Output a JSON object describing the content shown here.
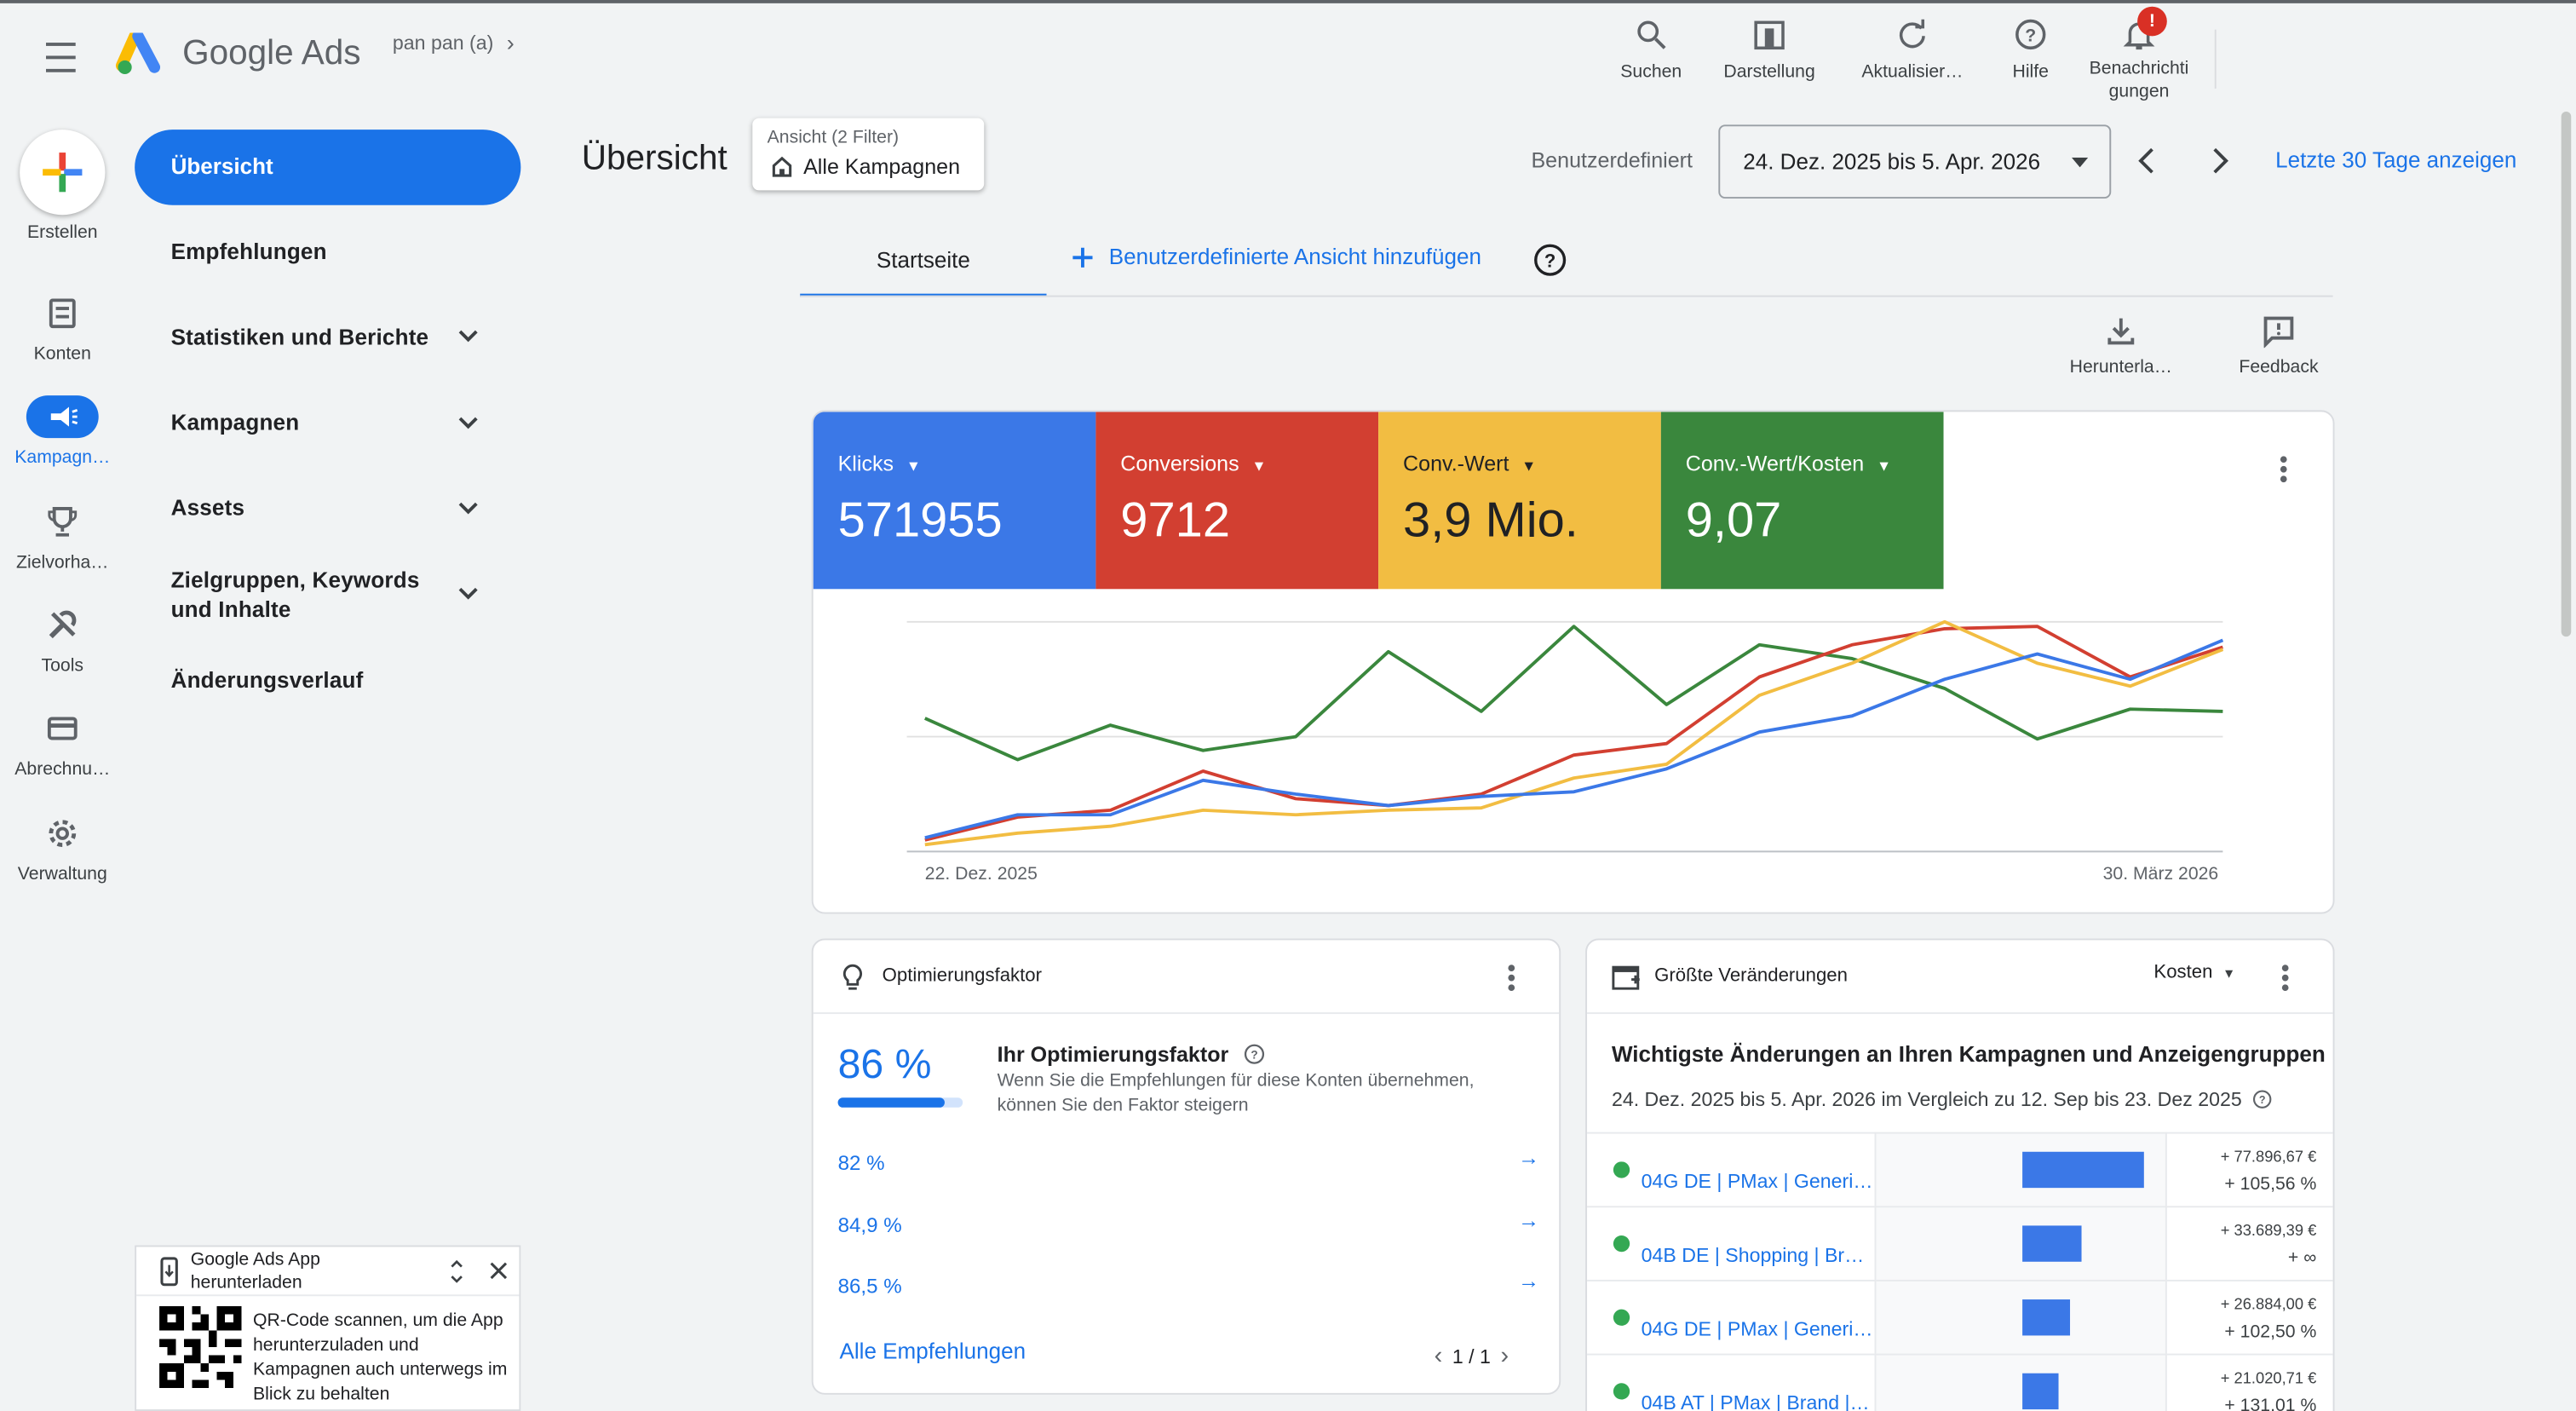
{
  "header": {
    "app_name": "Google Ads",
    "account": "pan pan (a)",
    "actions": [
      {
        "label": "Suchen",
        "icon": "search-icon"
      },
      {
        "label": "Darstellung",
        "icon": "appearance-icon"
      },
      {
        "label": "Aktualisier…",
        "icon": "refresh-icon"
      },
      {
        "label": "Hilfe",
        "icon": "help-icon"
      },
      {
        "label": "Benachrichti\ngungen",
        "icon": "bell-icon",
        "badge": "!"
      }
    ]
  },
  "rail": {
    "create_label": "Erstellen",
    "items": [
      {
        "label": "Konten",
        "icon": "accounts-icon"
      },
      {
        "label": "Kampagn…",
        "icon": "campaigns-icon",
        "active": true
      },
      {
        "label": "Zielvorha…",
        "icon": "trophy-icon"
      },
      {
        "label": "Tools",
        "icon": "tools-icon"
      },
      {
        "label": "Abrechnu…",
        "icon": "billing-icon"
      },
      {
        "label": "Verwaltung",
        "icon": "settings-icon"
      }
    ]
  },
  "sidebar": {
    "items": [
      {
        "label": "Übersicht",
        "active": true
      },
      {
        "label": "Empfehlungen"
      },
      {
        "label": "Statistiken und Berichte",
        "expandable": true
      },
      {
        "label": "Kampagnen",
        "expandable": true
      },
      {
        "label": "Assets",
        "expandable": true
      },
      {
        "label": "Zielgruppen, Keywords und Inhalte",
        "expandable": true
      },
      {
        "label": "Änderungsverlauf"
      }
    ]
  },
  "app_promo": {
    "title": "Google Ads App herunterladen",
    "text": "QR-Code scannen, um die App herunterzuladen und Kampagnen auch unterwegs im Blick zu behalten"
  },
  "page": {
    "title": "Übersicht",
    "view_filter_label": "Ansicht (2 Filter)",
    "view_filter_value": "Alle Kampagnen",
    "date_mode": "Benutzerdefiniert",
    "date_range": "24. Dez. 2025 bis 5. Apr. 2026",
    "last30_link": "Letzte 30 Tage anzeigen",
    "tab_home": "Startseite",
    "add_view": "Benutzerdefinierte Ansicht hinzufügen",
    "download_label": "Herunterla…",
    "feedback_label": "Feedback"
  },
  "metrics": [
    {
      "label": "Klicks",
      "value": "571955",
      "color": "#3b78e7"
    },
    {
      "label": "Conversions",
      "value": "9712",
      "color": "#d23f31"
    },
    {
      "label": "Conv.-Wert",
      "value": "3,9 Mio.",
      "color": "#f2bd42"
    },
    {
      "label": "Conv.-Wert/Kosten",
      "value": "9,07",
      "color": "#3a873d"
    }
  ],
  "chart_data": {
    "type": "line",
    "x_start_label": "22. Dez. 2025",
    "x_end_label": "30. März 2026",
    "grid": true,
    "normalized": true,
    "series": [
      {
        "color": "#3a873d",
        "values": [
          0.58,
          0.4,
          0.55,
          0.44,
          0.5,
          0.87,
          0.61,
          0.98,
          0.64,
          0.9,
          0.84,
          0.71,
          0.49,
          0.62,
          0.61
        ]
      },
      {
        "color": "#d23f31",
        "values": [
          0.05,
          0.15,
          0.18,
          0.35,
          0.23,
          0.2,
          0.25,
          0.42,
          0.47,
          0.76,
          0.9,
          0.97,
          0.98,
          0.76,
          0.89
        ]
      },
      {
        "color": "#f2bd42",
        "values": [
          0.03,
          0.08,
          0.11,
          0.18,
          0.16,
          0.18,
          0.19,
          0.32,
          0.38,
          0.68,
          0.82,
          1.0,
          0.82,
          0.72,
          0.88
        ]
      },
      {
        "color": "#3b78e7",
        "values": [
          0.06,
          0.16,
          0.16,
          0.31,
          0.25,
          0.2,
          0.24,
          0.26,
          0.36,
          0.52,
          0.59,
          0.75,
          0.86,
          0.75,
          0.92
        ]
      }
    ]
  },
  "optimization": {
    "title": "Optimierungsfaktor",
    "score": "86 %",
    "score_fraction": 0.86,
    "heading": "Ihr Optimierungsfaktor",
    "description": "Wenn Sie die Empfehlungen für diese Konten übernehmen, können Sie den Faktor steigern",
    "items": [
      "82 %",
      "84,9 %",
      "86,5 %"
    ],
    "all_link": "Alle Empfehlungen",
    "pager": "1 / 1"
  },
  "changes": {
    "title": "Größte Veränderungen",
    "metric": "Kosten",
    "heading": "Wichtigste Änderungen an Ihren Kampagnen und Anzeigengruppen",
    "subheading": "24. Dez. 2025 bis 5. Apr. 2026 im Vergleich zu 12. Sep bis 23. Dez 2025",
    "rows": [
      {
        "name": "04G DE | PMax | Generi…",
        "abs": "+ 77.896,67 €",
        "pct": "+ 105,56 %",
        "bar": 1.0
      },
      {
        "name": "04B DE | Shopping | Br…",
        "abs": "+ 33.689,39 €",
        "pct": "+ ∞",
        "bar": 0.49
      },
      {
        "name": "04G DE | PMax | Generi…",
        "abs": "+ 26.884,00 €",
        "pct": "+ 102,50 %",
        "bar": 0.39
      },
      {
        "name": "04B AT | PMax | Brand |…",
        "abs": "+ 21.020,71 €",
        "pct": "+ 131,01 %",
        "bar": 0.3
      }
    ]
  }
}
